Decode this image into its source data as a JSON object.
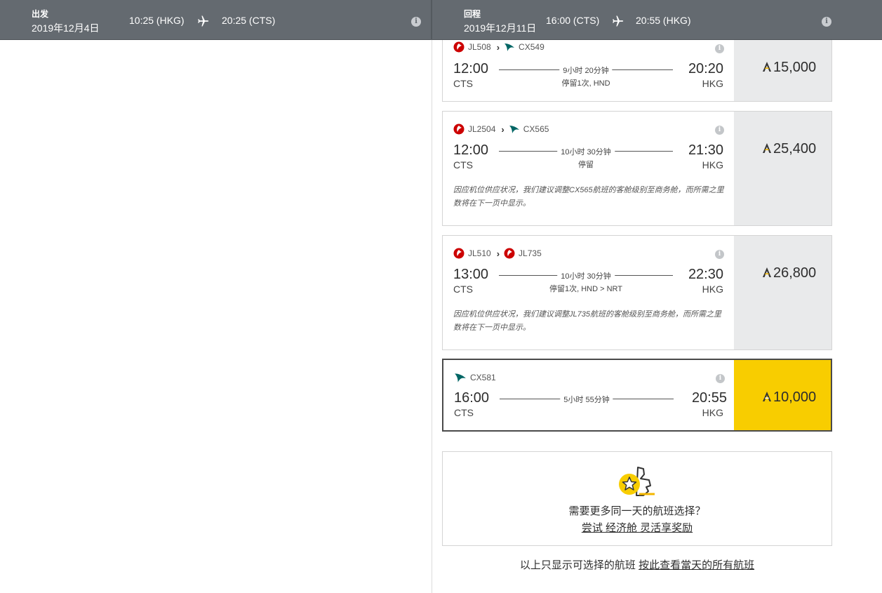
{
  "outbound": {
    "label": "出发",
    "date": "2019年12月4日",
    "depart": "10:25 (HKG)",
    "arrive": "20:25 (CTS)"
  },
  "return": {
    "label": "回程",
    "date": "2019年12月11日",
    "depart": "16:00 (CTS)",
    "arrive": "20:55 (HKG)"
  },
  "colors": {
    "topbar": "#646a70",
    "selected_price": "#f8cd00",
    "price_bg": "#e9eaeb",
    "jal_red": "#cc0000",
    "cathay_green": "#006564"
  },
  "flights": [
    {
      "segments": [
        {
          "airline": "jal-logo-icon",
          "code": "JL508"
        },
        {
          "airline": "cathay-logo-icon",
          "code": "CX549"
        }
      ],
      "dep_time": "12:00",
      "dep_city": "CTS",
      "arr_time": "20:20",
      "arr_city": "HKG",
      "duration": "9小时 20分钟",
      "stops": "停留1次, HND",
      "price": "15,000",
      "note": ""
    },
    {
      "segments": [
        {
          "airline": "jal-logo-icon",
          "code": "JL2504"
        },
        {
          "airline": "cathay-logo-icon",
          "code": "CX565"
        }
      ],
      "dep_time": "12:00",
      "dep_city": "CTS",
      "arr_time": "21:30",
      "arr_city": "HKG",
      "duration": "10小时 30分钟",
      "stops": "停留",
      "price": "25,400",
      "note": "因应机位供应状况，我们建议调整CX565航班的客舱级别至商务舱，而所需之里数将在下一页中显示。"
    },
    {
      "segments": [
        {
          "airline": "jal-logo-icon",
          "code": "JL510"
        },
        {
          "airline": "jal-logo-icon",
          "code": "JL735"
        }
      ],
      "dep_time": "13:00",
      "dep_city": "CTS",
      "arr_time": "22:30",
      "arr_city": "HKG",
      "duration": "10小时 30分钟",
      "stops": "停留1次, HND > NRT",
      "price": "26,800",
      "note": "因应机位供应状况，我们建议调整JL735航班的客舱级别至商务舱，而所需之里数将在下一页中显示。"
    },
    {
      "segments": [
        {
          "airline": "cathay-logo-icon",
          "code": "CX581"
        }
      ],
      "dep_time": "16:00",
      "dep_city": "CTS",
      "arr_time": "20:55",
      "arr_city": "HKG",
      "duration": "5小时 55分钟",
      "stops": "",
      "price": "10,000",
      "note": "",
      "selected": true
    }
  ],
  "more_options": {
    "question": "需要更多同一天的航班选择？",
    "link": "尝试 经济舱 灵活享奖励"
  },
  "footer": {
    "text": "以上只显示可选择的航班 ",
    "link": "按此查看當天的所有航班"
  }
}
